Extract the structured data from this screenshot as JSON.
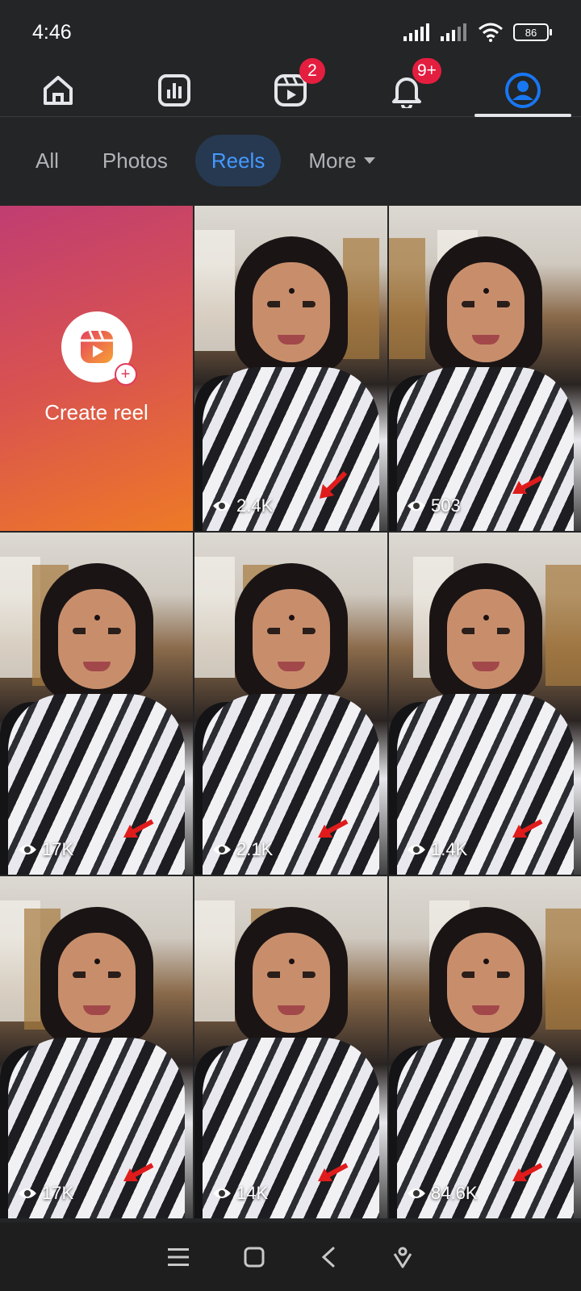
{
  "status_bar": {
    "time": "4:46",
    "battery": "86"
  },
  "nav": {
    "items": [
      {
        "name": "home"
      },
      {
        "name": "dashboard"
      },
      {
        "name": "reels",
        "badge": "2"
      },
      {
        "name": "notifications",
        "badge": "9+"
      },
      {
        "name": "profile",
        "active": true
      }
    ]
  },
  "filters": {
    "tabs": [
      {
        "label": "All"
      },
      {
        "label": "Photos"
      },
      {
        "label": "Reels",
        "active": true
      },
      {
        "label": "More"
      }
    ]
  },
  "create_reel": {
    "label": "Create reel"
  },
  "reels": [
    {
      "views": "2.4K"
    },
    {
      "views": "503"
    },
    {
      "views": "17K"
    },
    {
      "views": "2.1K"
    },
    {
      "views": "1.4K"
    },
    {
      "views": "17K"
    },
    {
      "views": "14K"
    },
    {
      "views": "84.6K"
    }
  ],
  "colors": {
    "background": "#242526",
    "accent": "#4599ff",
    "badge": "#e41e3f",
    "active_chip_bg": "#263951"
  }
}
